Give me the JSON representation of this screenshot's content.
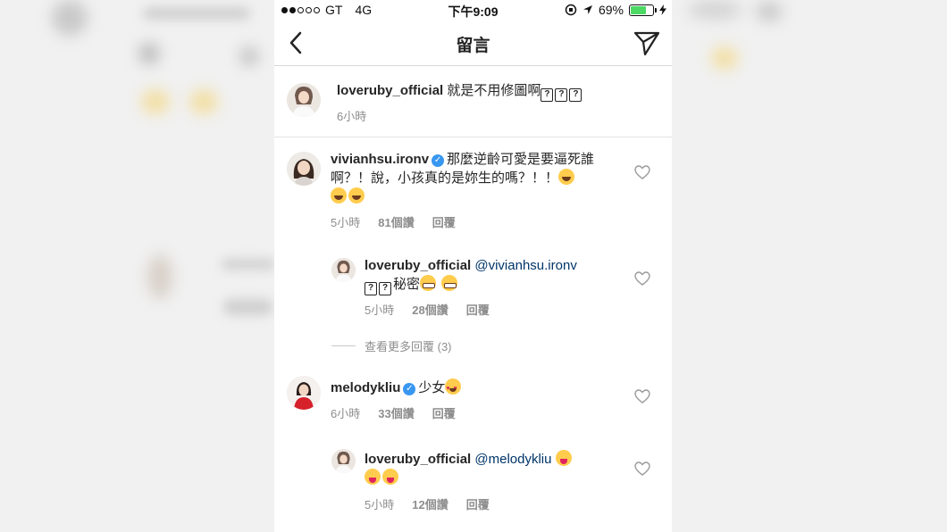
{
  "status_bar": {
    "carrier": "GT",
    "network": "4G",
    "time": "下午9:09",
    "battery": "69%",
    "battery_level": 0.69
  },
  "nav": {
    "title": "留言"
  },
  "caption": {
    "username": "loveruby_official",
    "text": "就是不用修圖啊",
    "time": "6小時"
  },
  "comments": [
    {
      "username": "vivianhsu.ironv",
      "text_line1": "那麼逆齡可愛是要逼死誰",
      "text_line2": "啊？！說，小孩真的是妳生的嗎？！！",
      "time": "5小時",
      "likes": "81個讚",
      "reply": "回覆"
    },
    {
      "username": "loveruby_official",
      "mention": "@vivianhsu.ironv",
      "text": "秘密",
      "time": "5小時",
      "likes": "28個讚",
      "reply": "回覆"
    },
    {
      "username": "melodykliu",
      "text": "少女",
      "time": "6小時",
      "likes": "33個讚",
      "reply": "回覆"
    },
    {
      "username": "loveruby_official",
      "mention": "@melodykliu",
      "time": "5小時",
      "likes": "12個讚",
      "reply": "回覆"
    }
  ],
  "view_more": "查看更多回覆 (3)",
  "icons": {
    "back": "chevron-left-icon",
    "send": "paper-plane-icon",
    "heart": "heart-outline-icon",
    "verified": "verified-badge-icon"
  },
  "colors": {
    "verified": "#3897f0",
    "mention": "#003569",
    "battery": "#4cd964"
  }
}
